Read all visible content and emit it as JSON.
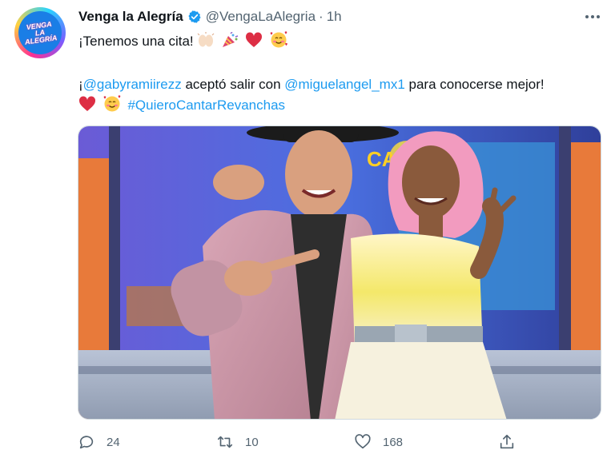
{
  "tweet": {
    "author": {
      "display_name": "Venga la Alegría",
      "handle": "@VengaLaAlegria",
      "verified": true,
      "avatar_logo_line1": "VENGA",
      "avatar_logo_line2": "LA ALEGRÍA"
    },
    "separator": "·",
    "time": "1h",
    "line1_text": "¡Tenemos una cita! ",
    "line1_emojis": [
      "raising-hands-emoji",
      "party-popper-emoji",
      "red-heart-emoji",
      "smiling-face-with-hearts-emoji"
    ],
    "line2_prefix": "¡",
    "mention1": "@gabyramiirezz",
    "line2_middle": " aceptó salir con ",
    "mention2": "@miguelangel_mx1",
    "line2_suffix": " para conocerse mejor!",
    "line3_emojis": [
      "red-heart-emoji",
      "smiling-face-with-hearts-emoji"
    ],
    "hashtag": "#QuieroCantarRevanchas",
    "media": {
      "type": "photo",
      "set_logo_text": "CANTA"
    },
    "actions": {
      "reply_count": "24",
      "retweet_count": "10",
      "like_count": "168"
    },
    "icons": {
      "more": "more-horizontal-icon",
      "reply": "reply-icon",
      "retweet": "retweet-icon",
      "like": "heart-icon",
      "share": "share-icon",
      "verified": "verified-badge-icon"
    },
    "colors": {
      "link": "#1d9bf0",
      "secondary_text": "#536471",
      "verified": "#1d9bf0"
    }
  }
}
